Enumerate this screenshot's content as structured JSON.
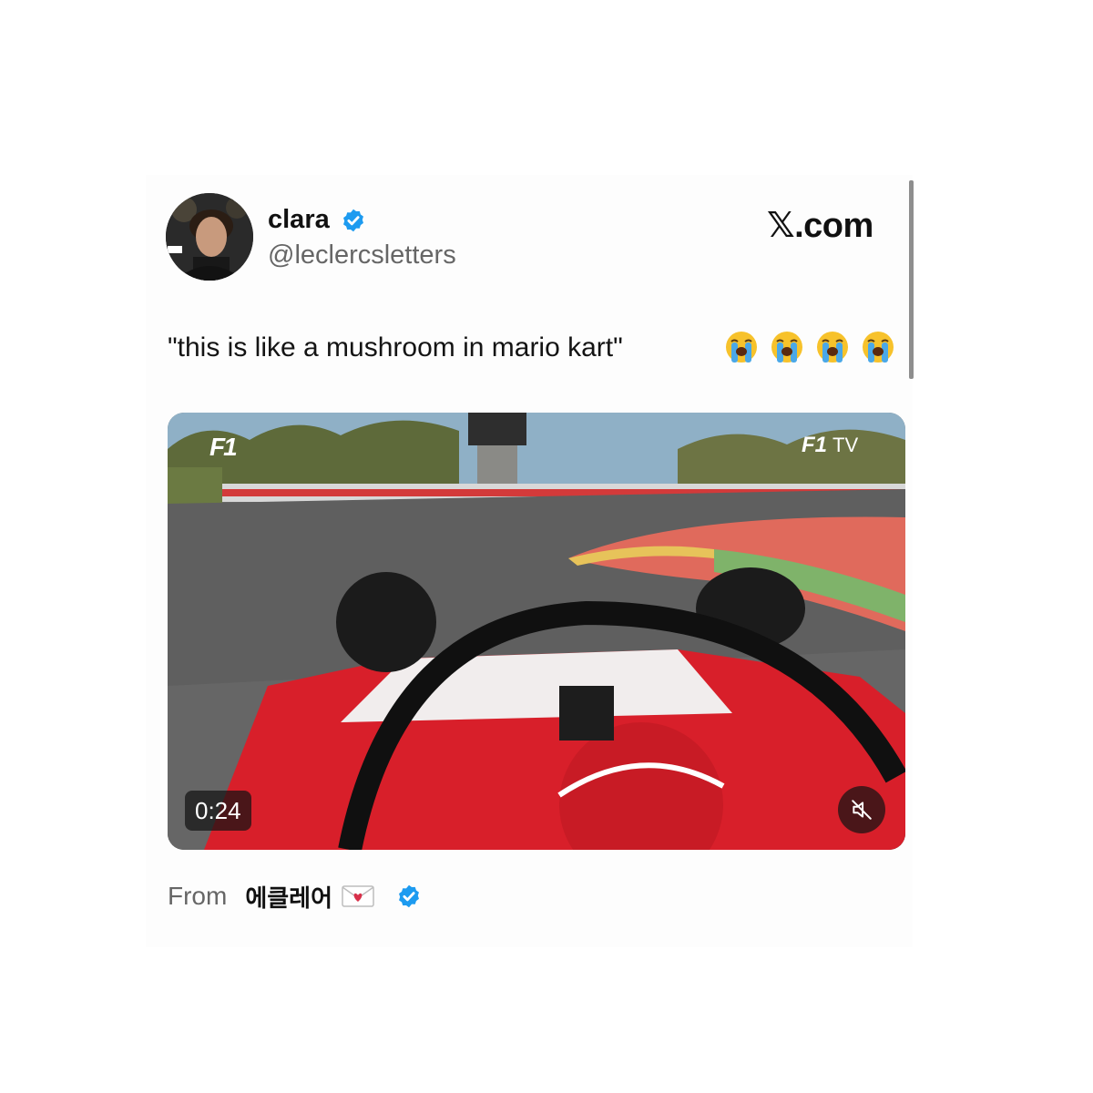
{
  "tweet": {
    "display_name": "clara",
    "handle": "@leclercsletters",
    "text": "\"this is like a mushroom in mario kart\"",
    "emojis": [
      "loudly-crying-face-icon",
      "loudly-crying-face-icon",
      "loudly-crying-face-icon",
      "loudly-crying-face-icon"
    ]
  },
  "brand": {
    "label": "𝕏.com"
  },
  "video": {
    "duration": "0:24",
    "f1_logo": "F1",
    "f1tv_logo": "F1",
    "f1tv_suffix": "TV",
    "mute_icon": "speaker-muted-icon"
  },
  "footer": {
    "from_label": "From",
    "source_name": "에클레어"
  },
  "colors": {
    "verified_blue": "#1d9bf0",
    "text_primary": "#111111",
    "text_secondary": "#666666",
    "ferrari_red": "#d81f2a"
  }
}
